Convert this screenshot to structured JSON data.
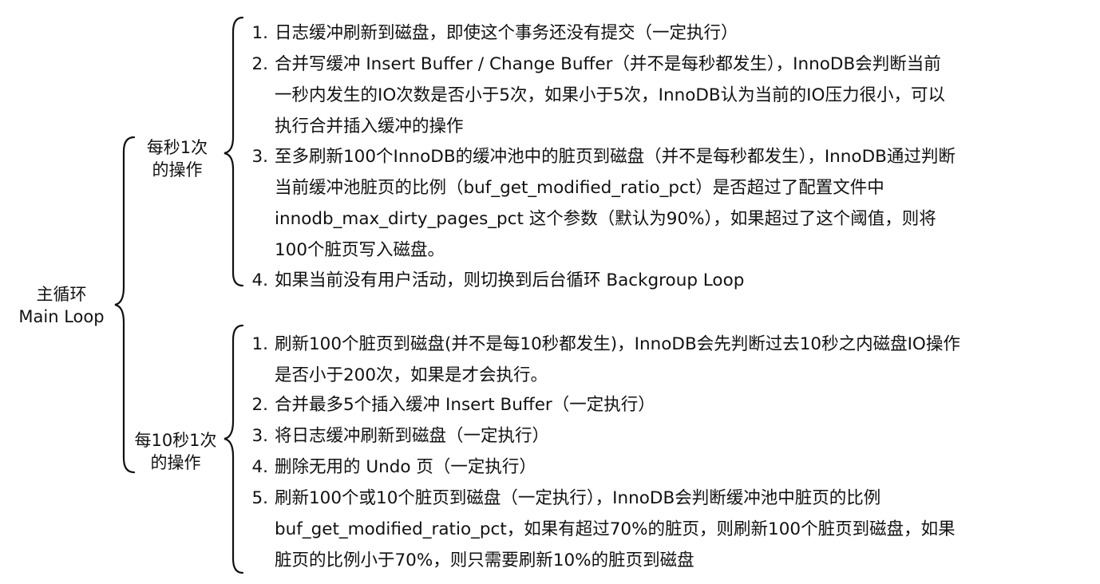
{
  "root": {
    "title_cn": "主循环",
    "title_en": "Main Loop"
  },
  "groups": [
    {
      "label_l1": "每秒1次",
      "label_l2": "的操作",
      "items": [
        {
          "num": "1.",
          "lines": [
            "日志缓冲刷新到磁盘，即使这个事务还没有提交（一定执行）"
          ]
        },
        {
          "num": "2.",
          "lines": [
            "合并写缓冲 Insert Buffer / Change Buffer（并不是每秒都发生），InnoDB会判断当前",
            "一秒内发生的IO次数是否小于5次，如果小于5次，InnoDB认为当前的IO压力很小，可以",
            "执行合并插入缓冲的操作"
          ]
        },
        {
          "num": "3.",
          "lines": [
            "至多刷新100个InnoDB的缓冲池中的脏页到磁盘（并不是每秒都发生），InnoDB通过判断",
            "当前缓冲池脏页的比例（buf_get_modified_ratio_pct）是否超过了配置文件中",
            "innodb_max_dirty_pages_pct 这个参数（默认为90%），如果超过了这个阈值，则将",
            "100个脏页写入磁盘。"
          ]
        },
        {
          "num": "4.",
          "lines": [
            "如果当前没有用户活动，则切换到后台循环 Backgroup Loop"
          ]
        }
      ]
    },
    {
      "label_l1": "每10秒1次",
      "label_l2": "的操作",
      "items": [
        {
          "num": "1.",
          "lines": [
            "刷新100个脏页到磁盘(并不是每10秒都发生)，InnoDB会先判断过去10秒之内磁盘IO操作",
            "是否小于200次，如果是才会执行。"
          ]
        },
        {
          "num": "2.",
          "lines": [
            "合并最多5个插入缓冲 Insert Buffer（一定执行）"
          ]
        },
        {
          "num": "3.",
          "lines": [
            "将日志缓冲刷新到磁盘（一定执行）"
          ]
        },
        {
          "num": "4.",
          "lines": [
            "删除无用的 Undo 页（一定执行）"
          ]
        },
        {
          "num": "5.",
          "lines": [
            "刷新100个或10个脏页到磁盘（一定执行），InnoDB会判断缓冲池中脏页的比例",
            "buf_get_modified_ratio_pct，如果有超过70%的脏页，则刷新100个脏页到磁盘，如果",
            "脏页的比例小于70%，则只需要刷新10%的脏页到磁盘"
          ]
        }
      ]
    }
  ]
}
